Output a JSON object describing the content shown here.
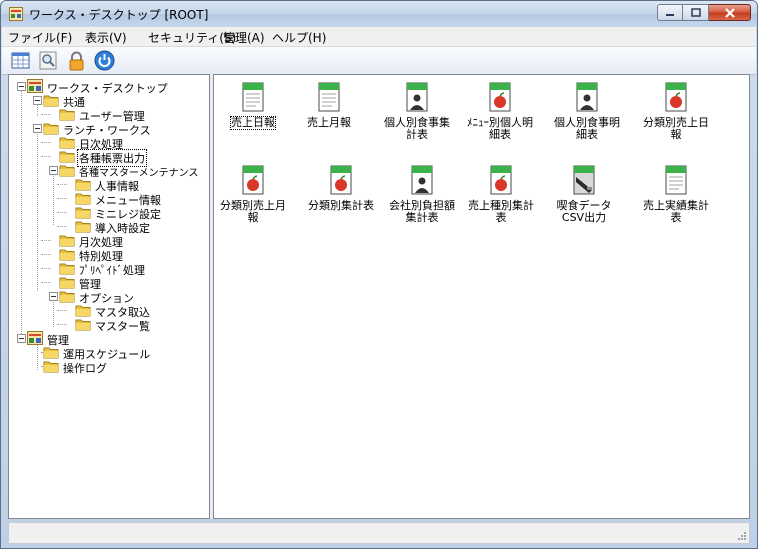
{
  "window": {
    "title": "ワークス・デスクトップ [ROOT]"
  },
  "menu": [
    "ファイル(F)",
    "表示(V)",
    "セキュリティ(S)",
    "管理(A)",
    "ヘルプ(H)"
  ],
  "toolbar": {
    "icons": [
      "grid-view-icon",
      "search-icon",
      "lock-icon",
      "power-icon"
    ]
  },
  "tree": {
    "root1": "ワークス・デスクトップ",
    "common": "共通",
    "user_mgmt": "ユーザー管理",
    "lunch_works": "ランチ・ワークス",
    "daily": "日次処理",
    "reports": "各種帳票出力",
    "master_maint": "各種マスターメンテナンス",
    "hr_info": "人事情報",
    "menu_info": "メニュー情報",
    "register_settings": "ミニレジ設定",
    "install_settings": "導入時設定",
    "monthly": "月次処理",
    "special": "特別処理",
    "prepaid": "ﾌﾟﾘﾍﾟｲﾄﾞ処理",
    "admin": "管理",
    "options": "オプション",
    "master_import": "マスタ取込",
    "master_list": "マスター覧",
    "root2": "管理",
    "schedule": "運用スケジュール",
    "oplog": "操作ログ"
  },
  "items": [
    {
      "label": "売上日報",
      "icon": "report-green-icon"
    },
    {
      "label": "売上月報",
      "icon": "report-green-icon"
    },
    {
      "label": "個人別食事集計表",
      "icon": "report-person-icon"
    },
    {
      "label": "ﾒﾆｭｰ別個人明細表",
      "icon": "report-apple-icon"
    },
    {
      "label": "個人別食事明細表",
      "icon": "report-person-icon"
    },
    {
      "label": "分類別売上日報",
      "icon": "report-apple-icon"
    },
    {
      "label": "分類別売上月報",
      "icon": "report-apple-icon"
    },
    {
      "label": "分類別集計表",
      "icon": "report-apple-icon"
    },
    {
      "label": "会社別負担額集計表",
      "icon": "report-person-icon"
    },
    {
      "label": "売上種別集計表",
      "icon": "report-apple-icon"
    },
    {
      "label": "喫食データCSV出力",
      "icon": "export-csv-icon"
    },
    {
      "label": "売上実績集計表",
      "icon": "report-plain-icon"
    }
  ],
  "status": {
    "text": ""
  }
}
